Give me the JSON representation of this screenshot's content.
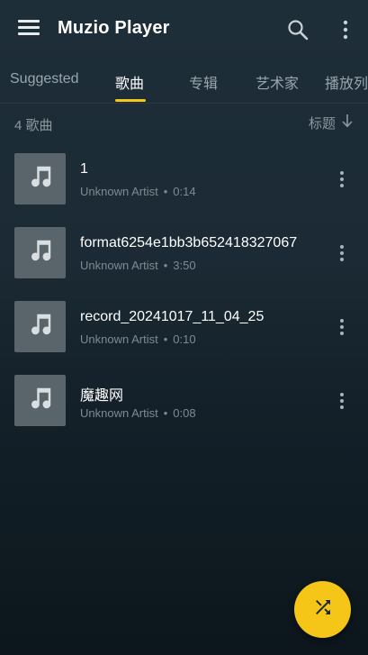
{
  "app_bar": {
    "title": "Muzio Player",
    "icons": [
      "menu-icon",
      "search-icon",
      "more-vert-icon"
    ]
  },
  "tabs": [
    {
      "label": "Suggested",
      "active": false
    },
    {
      "label": "歌曲",
      "active": true
    },
    {
      "label": "专辑",
      "active": false
    },
    {
      "label": "艺术家",
      "active": false
    },
    {
      "label": "播放列",
      "active": false
    }
  ],
  "list_header": {
    "count_label": "4 歌曲",
    "sort_label": "标题",
    "sort_icon": "arrow-down-icon"
  },
  "songs": [
    {
      "title": "1",
      "artist": "Unknown Artist",
      "duration": "0:14"
    },
    {
      "title": "format6254e1bb3b652418327067",
      "artist": "Unknown Artist",
      "duration": "3:50"
    },
    {
      "title": "record_20241017_11_04_25",
      "artist": "Unknown Artist",
      "duration": "0:10"
    },
    {
      "title": "魔趣网",
      "artist": "Unknown Artist",
      "duration": "0:08"
    }
  ],
  "meta_separator": "•",
  "fab": {
    "icon": "shuffle-icon"
  },
  "colors": {
    "accent": "#f5c518",
    "background": "#1b2a34",
    "thumbnail": "#59646b",
    "secondary_text": "#7f8a91"
  }
}
